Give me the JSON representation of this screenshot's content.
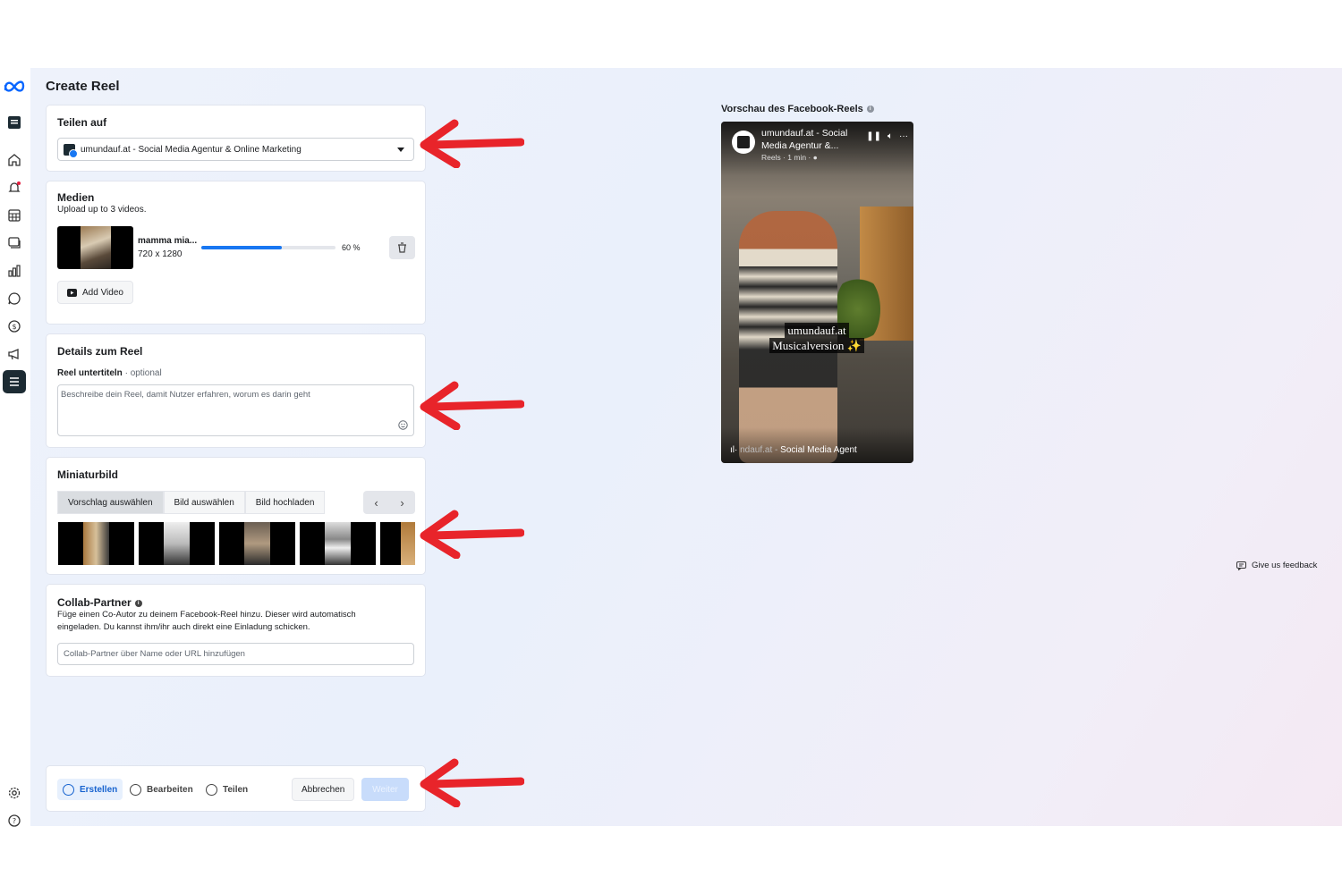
{
  "page": {
    "title": "Create Reel"
  },
  "share_on": {
    "title": "Teilen auf",
    "selected_page": "umundauf.at - Social Media Agentur & Online Marketing"
  },
  "media": {
    "title": "Medien",
    "subtitle": "Upload up to 3 videos.",
    "file_name": "mamma mia...",
    "dimensions": "720 x 1280",
    "progress_percent": 60,
    "progress_label": "60 %",
    "add_video_label": "Add Video"
  },
  "details": {
    "title": "Details zum Reel",
    "caption_label": "Reel untertiteln",
    "caption_optional": "optional",
    "caption_placeholder": "Beschreibe dein Reel, damit Nutzer erfahren, worum es darin geht"
  },
  "thumbnail": {
    "title": "Miniaturbild",
    "tabs": [
      "Vorschlag auswählen",
      "Bild auswählen",
      "Bild hochladen"
    ],
    "active_tab": 0
  },
  "collab": {
    "title": "Collab-Partner",
    "description": "Füge einen Co-Autor zu deinem Facebook-Reel hinzu. Dieser wird automatisch eingeladen. Du kannst ihm/ihr auch direkt eine Einladung schicken.",
    "placeholder": "Collab-Partner über Name oder URL hinzufügen"
  },
  "footer": {
    "steps": [
      "Erstellen",
      "Bearbeiten",
      "Teilen"
    ],
    "cancel_label": "Abbrechen",
    "next_label": "Weiter"
  },
  "preview": {
    "label": "Vorschau des Facebook-Reels",
    "account_name": "umundauf.at - Social Media Agentur &...",
    "meta": "Reels · 1 min ·",
    "caption_line1": "umundauf.at",
    "caption_line2": "Musicalversion ✨",
    "footer_dim": "ndauf.at -",
    "footer_text": "Social Media Agent"
  },
  "feedback_label": "Give us feedback",
  "colors": {
    "accent": "#1877f2",
    "annotation_arrow": "#e8242a"
  }
}
